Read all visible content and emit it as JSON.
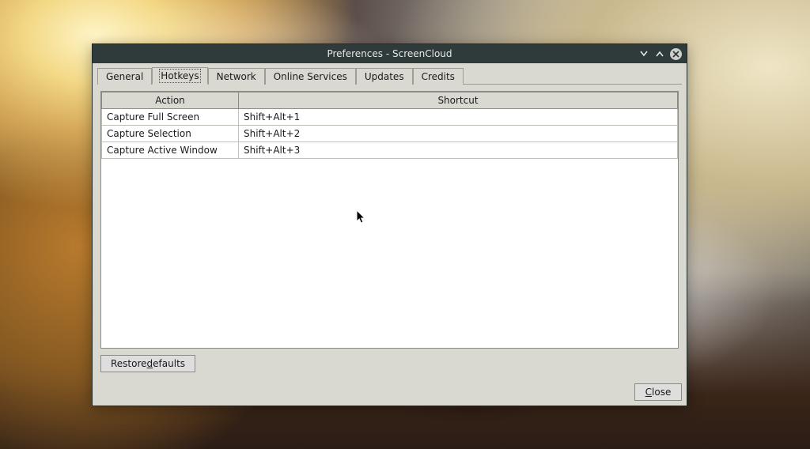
{
  "window": {
    "title": "Preferences - ScreenCloud"
  },
  "tabs": {
    "general": "General",
    "hotkeys": "Hotkeys",
    "network": "Network",
    "online": "Online Services",
    "updates": "Updates",
    "credits": "Credits",
    "active": "hotkeys"
  },
  "hotkeys_table": {
    "headers": {
      "action": "Action",
      "shortcut": "Shortcut"
    },
    "rows": [
      {
        "action": "Capture Full Screen",
        "shortcut": "Shift+Alt+1"
      },
      {
        "action": "Capture Selection",
        "shortcut": "Shift+Alt+2"
      },
      {
        "action": "Capture Active Window",
        "shortcut": "Shift+Alt+3"
      }
    ]
  },
  "buttons": {
    "restore_defaults_prefix": "Restore ",
    "restore_defaults_ul": "d",
    "restore_defaults_suffix": "efaults",
    "close_ul": "C",
    "close_suffix": "lose"
  }
}
